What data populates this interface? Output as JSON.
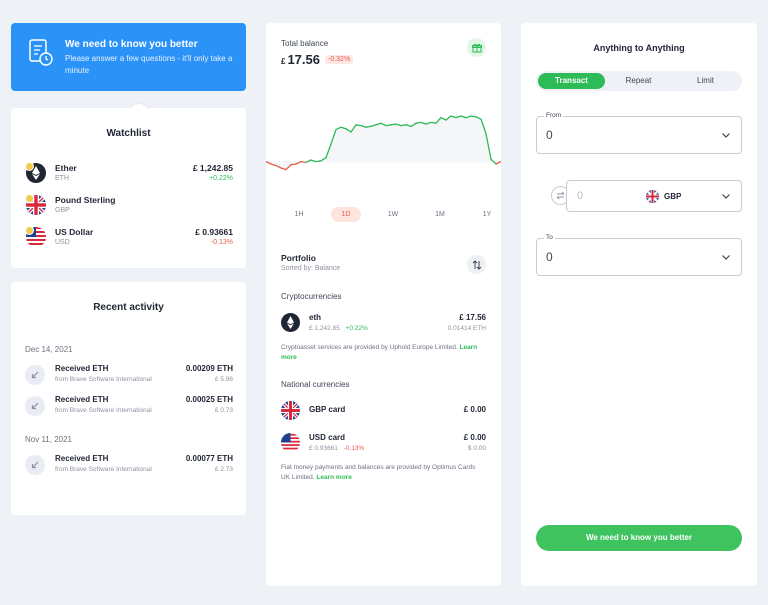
{
  "banner": {
    "title": "We need to know you better",
    "subtitle": "Please answer a few questions - it'll only take a minute"
  },
  "watchlist": {
    "title": "Watchlist",
    "items": [
      {
        "name": "Ether",
        "symbol": "ETH",
        "value": "£ 1,242.85",
        "change": "+0.22%",
        "change_dir": "up"
      },
      {
        "name": "Pound Sterling",
        "symbol": "GBP",
        "value": "",
        "change": "",
        "change_dir": ""
      },
      {
        "name": "US Dollar",
        "symbol": "USD",
        "value": "£ 0.93661",
        "change": "-0.13%",
        "change_dir": "down"
      }
    ]
  },
  "recent": {
    "title": "Recent activity",
    "groups": [
      {
        "date": "Dec 14, 2021",
        "items": [
          {
            "name": "Received ETH",
            "from": "from Brave Software International",
            "amount": "0.00209 ETH",
            "fiat": "£ 5.96"
          },
          {
            "name": "Received ETH",
            "from": "from Brave Software International",
            "amount": "0.00025 ETH",
            "fiat": "£ 0.73"
          }
        ]
      },
      {
        "date": "Nov 11, 2021",
        "items": [
          {
            "name": "Received ETH",
            "from": "from Brave Software International",
            "amount": "0.00077 ETH",
            "fiat": "£ 2.73"
          }
        ]
      }
    ]
  },
  "balance": {
    "label": "Total balance",
    "currency": "£",
    "amount": "17.56",
    "change": "-0.32%"
  },
  "chart_data": {
    "type": "line",
    "title": "",
    "xlabel": "",
    "ylabel": "",
    "ylim": [
      0,
      10
    ],
    "grid": false,
    "values": [
      3.3,
      3.0,
      2.8,
      2.5,
      2.3,
      2.9,
      3.0,
      3.3,
      3.2,
      3.5,
      3.3,
      3.4,
      3.8,
      5.5,
      7.3,
      7.6,
      7.4,
      7.0,
      7.9,
      7.8,
      7.6,
      7.7,
      7.9,
      8.1,
      7.8,
      7.9,
      8.0,
      7.8,
      7.9,
      7.7,
      8.1,
      8.2,
      8.0,
      8.2,
      8.1,
      8.8,
      8.5,
      9.0,
      8.8,
      9.0,
      8.8,
      9.0,
      8.9,
      8.6,
      6.8,
      3.6,
      3.0,
      3.3
    ],
    "baseline": 3.3,
    "up_color": "#2dbb57",
    "down_color": "#e85d4b"
  },
  "ranges": [
    "1H",
    "1D",
    "1W",
    "1M",
    "1Y"
  ],
  "active_range": "1D",
  "portfolio": {
    "title": "Portfolio",
    "sorted_by": "Sorted by: Balance",
    "crypto_heading": "Cryptocurrencies",
    "crypto": [
      {
        "name": "eth",
        "price": "£ 1,242.85",
        "change": "+0.22%",
        "value": "£ 17.56",
        "amount": "0.01414 ETH"
      }
    ],
    "crypto_note": "Cryptoasset services are provided by Uphold Europe Limited.",
    "learn_more": "Learn more",
    "national_heading": "National currencies",
    "national": [
      {
        "name": "GBP card",
        "price": "",
        "change": "",
        "value": "£ 0.00",
        "amount": ""
      },
      {
        "name": "USD card",
        "price": "£ 0.93661",
        "change": "-0.13%",
        "value": "£ 0.00",
        "amount": "$ 0.00"
      }
    ],
    "national_note": "Fiat money payments and balances are provided by Optimus Cards UK Limited."
  },
  "swap": {
    "title": "Anything to Anything",
    "tabs": [
      "Transact",
      "Repeat",
      "Limit"
    ],
    "active_tab": "Transact",
    "from_label": "From",
    "from_value": "0",
    "mid_value": "0",
    "mid_currency": "GBP",
    "to_label": "To",
    "to_value": "0",
    "cta": "We need to know you better"
  }
}
